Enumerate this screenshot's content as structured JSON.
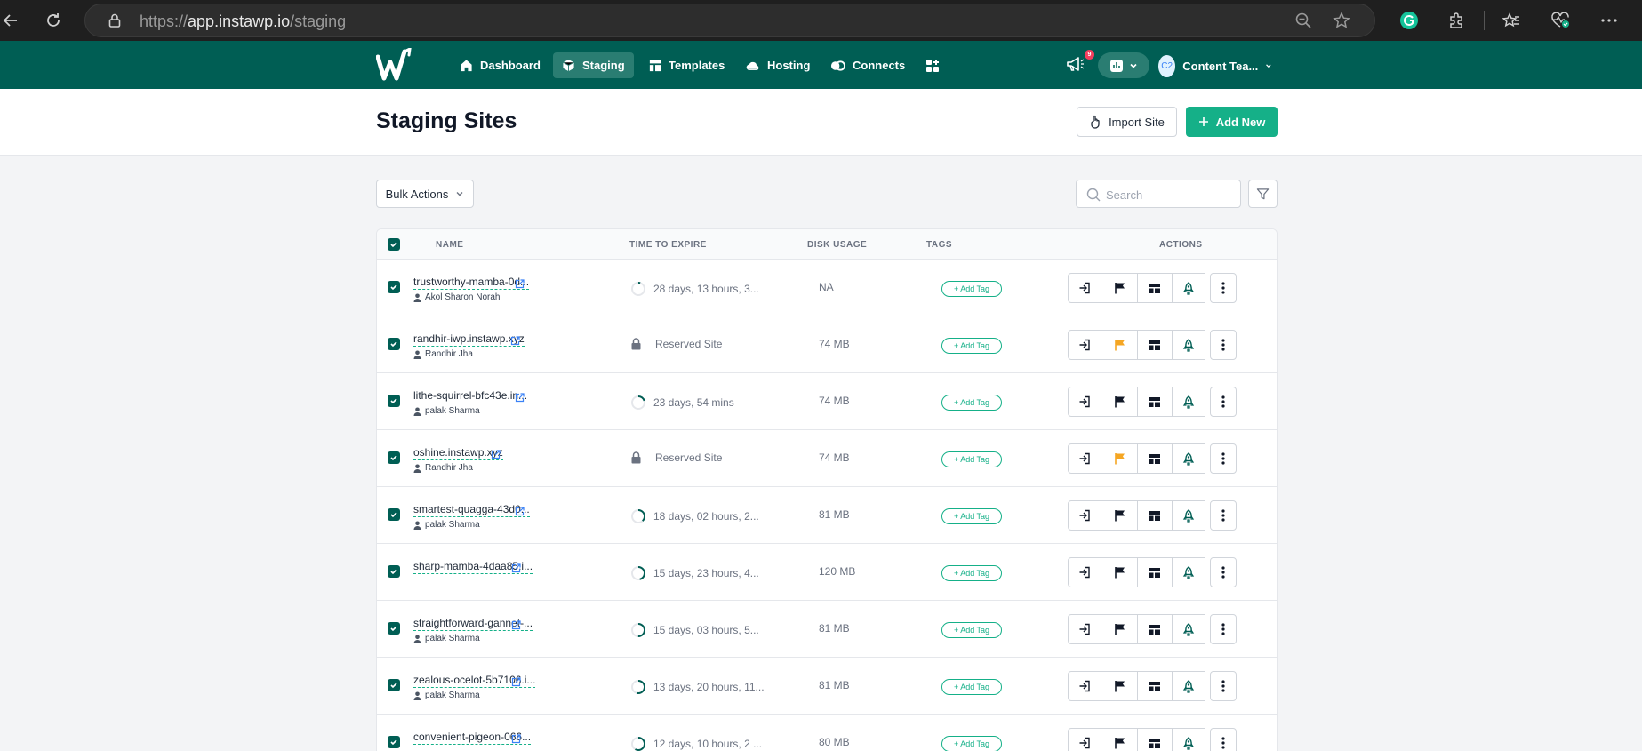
{
  "browser": {
    "url_prefix": "https://",
    "url_host": "app.instawp.io",
    "url_path": "/staging"
  },
  "nav": {
    "items": [
      {
        "label": "Dashboard",
        "icon": "home-icon"
      },
      {
        "label": "Staging",
        "icon": "cube-icon",
        "active": true
      },
      {
        "label": "Templates",
        "icon": "template-icon"
      },
      {
        "label": "Hosting",
        "icon": "cloud-icon"
      },
      {
        "label": "Connects",
        "icon": "link-icon"
      }
    ],
    "notification_count": "9",
    "avatar_initials": "C2",
    "user_name": "Content Tea..."
  },
  "header": {
    "title": "Staging Sites",
    "import_label": "Import Site",
    "add_label": "Add New"
  },
  "toolbar": {
    "bulk_label": "Bulk Actions",
    "search_placeholder": "Search"
  },
  "table": {
    "headers": {
      "name": "NAME",
      "expire": "TIME TO EXPIRE",
      "disk": "DISK USAGE",
      "tags": "TAGS",
      "actions": "ACTIONS"
    },
    "tag_label": "+ Add Tag",
    "rows": [
      {
        "name": "trustworthy-mamba-0d...",
        "owner": "Akol Sharon Norah",
        "expire": "28 days, 13 hours, 3...",
        "expire_fraction": 0.05,
        "disk": "NA",
        "reserved": false
      },
      {
        "name": "randhir-iwp.instawp.xyz",
        "owner": "Randhir Jha",
        "expire": "Reserved Site",
        "disk": "74 MB",
        "reserved": true
      },
      {
        "name": "lithe-squirrel-bfc43e.in...",
        "owner": "palak Sharma",
        "expire": "23 days, 54 mins",
        "expire_fraction": 0.2,
        "disk": "74 MB",
        "reserved": false
      },
      {
        "name": "oshine.instawp.xyz",
        "owner": "Randhir Jha",
        "expire": "Reserved Site",
        "disk": "74 MB",
        "reserved": true
      },
      {
        "name": "smartest-quagga-43d0...",
        "owner": "palak Sharma",
        "expire": "18 days, 02 hours, 2...",
        "expire_fraction": 0.38,
        "disk": "81 MB",
        "reserved": false
      },
      {
        "name": "sharp-mamba-4daa85.i...",
        "owner": "",
        "expire": "15 days, 23 hours, 4...",
        "expire_fraction": 0.46,
        "disk": "120 MB",
        "reserved": false
      },
      {
        "name": "straightforward-gannet-...",
        "owner": "palak Sharma",
        "expire": "15 days, 03 hours, 5...",
        "expire_fraction": 0.5,
        "disk": "81 MB",
        "reserved": false
      },
      {
        "name": "zealous-ocelot-5b7106.i...",
        "owner": "palak Sharma",
        "expire": "13 days, 20 hours, 11...",
        "expire_fraction": 0.54,
        "disk": "81 MB",
        "reserved": false
      },
      {
        "name": "convenient-pigeon-066...",
        "owner": "",
        "expire": "12 days, 10 hours, 2 ...",
        "expire_fraction": 0.58,
        "disk": "80 MB",
        "reserved": false
      }
    ]
  },
  "colors": {
    "brand": "#005e54",
    "accent": "#15b088",
    "flag_reserved": "#f5a623"
  }
}
